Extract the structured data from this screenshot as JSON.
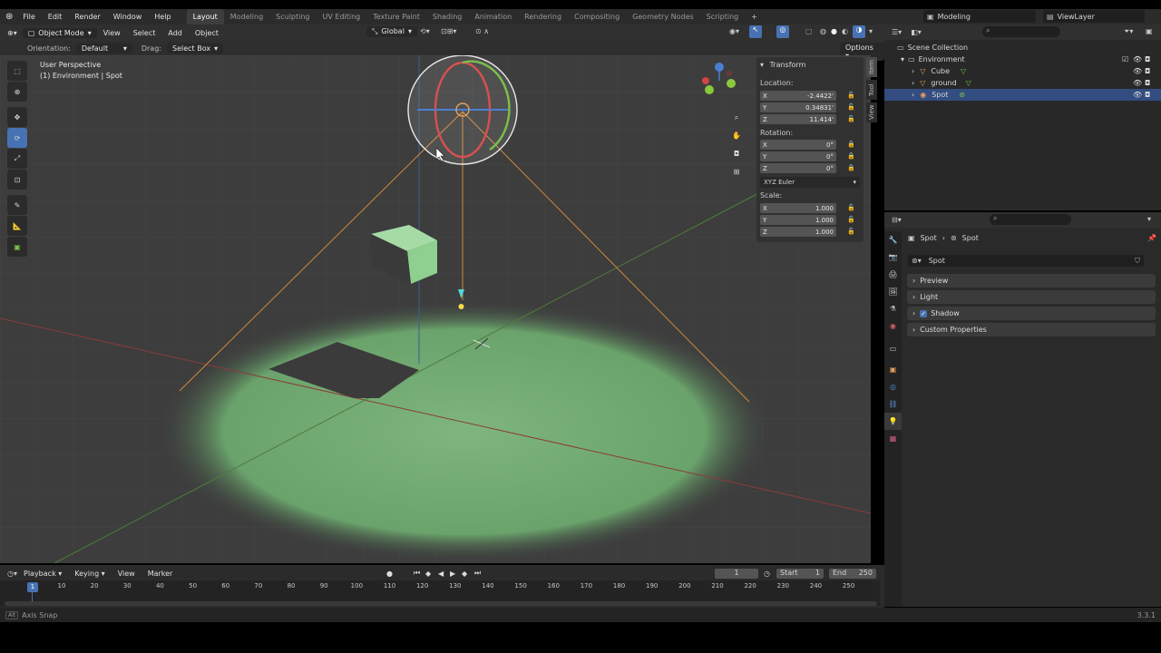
{
  "topbar": {
    "menus": [
      "File",
      "Edit",
      "Render",
      "Window",
      "Help"
    ],
    "workspaces": [
      "Layout",
      "Modeling",
      "Sculpting",
      "UV Editing",
      "Texture Paint",
      "Shading",
      "Animation",
      "Rendering",
      "Compositing",
      "Geometry Nodes",
      "Scripting"
    ],
    "add_tab": "+",
    "scene_name": "Modeling",
    "view_layer": "ViewLayer"
  },
  "viewport_header": {
    "mode": "Object Mode",
    "menus": [
      "View",
      "Select",
      "Add",
      "Object"
    ],
    "transform_orientation": "Global"
  },
  "viewport_subheader": {
    "orientation_label": "Orientation:",
    "orientation_value": "Default",
    "drag_label": "Drag:",
    "drag_value": "Select Box",
    "options": "Options"
  },
  "viewport": {
    "view_name": "User Perspective",
    "collection_info": "(1) Environment | Spot"
  },
  "npanel": {
    "title": "Transform",
    "location_label": "Location:",
    "location": [
      {
        "axis": "X",
        "value": "-2.4422'"
      },
      {
        "axis": "Y",
        "value": "0.34831'"
      },
      {
        "axis": "Z",
        "value": "11.414'"
      }
    ],
    "rotation_label": "Rotation:",
    "rotation": [
      {
        "axis": "X",
        "value": "0°"
      },
      {
        "axis": "Y",
        "value": "0°"
      },
      {
        "axis": "Z",
        "value": "0°"
      }
    ],
    "rotation_mode": "XYZ Euler",
    "scale_label": "Scale:",
    "scale": [
      {
        "axis": "X",
        "value": "1.000"
      },
      {
        "axis": "Y",
        "value": "1.000"
      },
      {
        "axis": "Z",
        "value": "1.000"
      }
    ],
    "tabs": [
      "Item",
      "Tool",
      "View"
    ]
  },
  "outliner": {
    "root": "Scene Collection",
    "collection": "Environment",
    "items": [
      "Cube",
      "ground",
      "Spot"
    ]
  },
  "properties": {
    "breadcrumb_object": "Spot",
    "breadcrumb_data": "Spot",
    "datablock": "Spot",
    "panels": [
      "Preview",
      "Light",
      "Shadow",
      "Custom Properties"
    ]
  },
  "timeline": {
    "menus": [
      "Playback",
      "Keying",
      "View",
      "Marker"
    ],
    "current_frame": "1",
    "start_label": "Start",
    "start_value": "1",
    "end_label": "End",
    "end_value": "250",
    "playhead": "1",
    "ticks": [
      "10",
      "20",
      "30",
      "40",
      "50",
      "60",
      "70",
      "80",
      "90",
      "100",
      "110",
      "120",
      "130",
      "140",
      "150",
      "160",
      "170",
      "180",
      "190",
      "200",
      "210",
      "220",
      "230",
      "240",
      "250"
    ]
  },
  "statusbar": {
    "hint_key": "Alt",
    "hint": "Axis Snap",
    "version": "3.3.1"
  },
  "colors": {
    "accent": "#4772b3",
    "selection": "#334d80",
    "light_green": "#8fd28f",
    "spot_cone": "#d08a3c"
  }
}
